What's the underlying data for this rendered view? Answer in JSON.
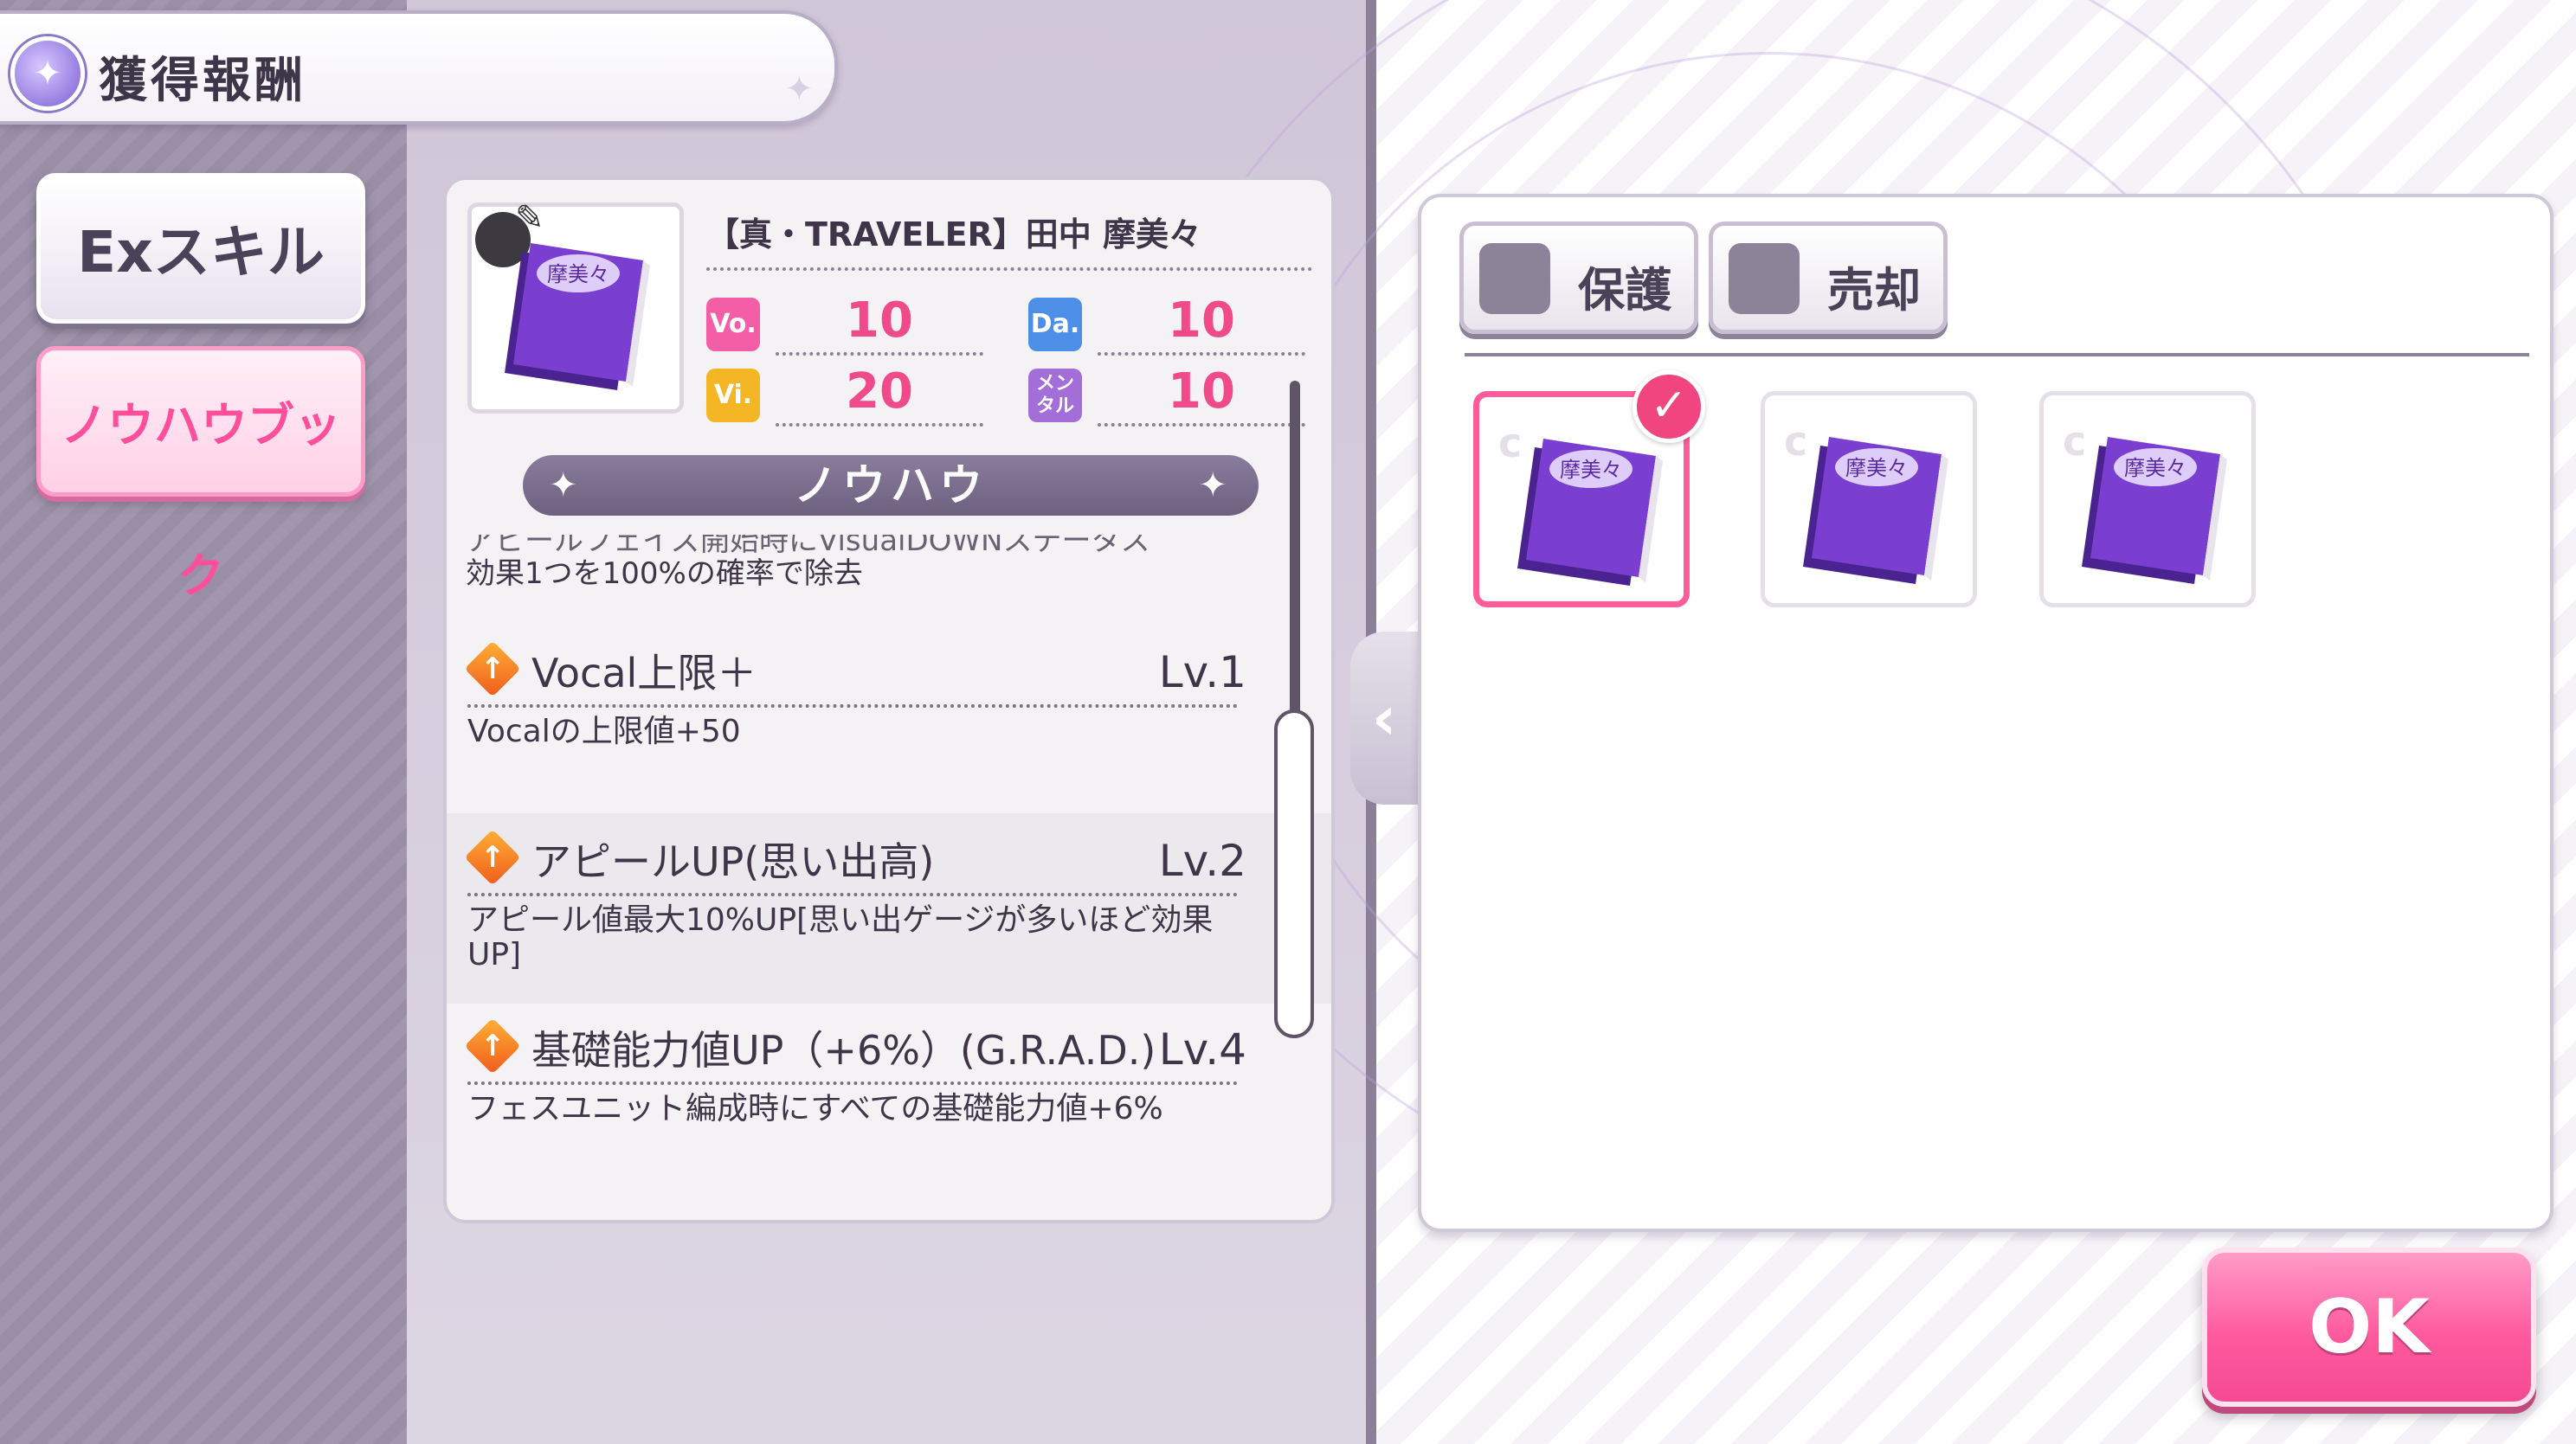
{
  "header": {
    "title": "獲得報酬"
  },
  "tabs": [
    {
      "label": "Exスキル",
      "active": false
    },
    {
      "label": "ノウハウブック",
      "active": true
    }
  ],
  "card": {
    "name": "【真・TRAVELER】田中 摩美々",
    "book_label": "摩美々",
    "stats": [
      {
        "badge": "Vo.",
        "value": "10",
        "color": "#f35ea6"
      },
      {
        "badge": "Da.",
        "value": "10",
        "color": "#4d8ee6"
      },
      {
        "badge": "Vi.",
        "value": "20",
        "color": "#f4b624"
      },
      {
        "badge": "メンタル",
        "value": "10",
        "color": "#a36ed8"
      }
    ]
  },
  "knowhow": {
    "title": "ノウハウ",
    "cut_text_line1": "アピールフェイズ開始時にVisualDOWNステータス",
    "cut_text_line2": "効果1つを100%の確率で除去",
    "items": [
      {
        "name": "Vocal上限＋",
        "level": "Lv.1",
        "desc": "Vocalの上限値+50"
      },
      {
        "name": "アピールUP(思い出高)",
        "level": "Lv.2",
        "desc": "アピール値最大10%UP[思い出ゲージが多いほど効果UP]"
      },
      {
        "name": "基礎能力値UP（+6%）(G.R.A.D.)",
        "level": "Lv.4",
        "desc": "フェスユニット編成時にすべての基礎能力値+6%"
      }
    ]
  },
  "filters": {
    "protect": "保護",
    "sell": "売却"
  },
  "inventory": [
    {
      "label": "摩美々",
      "selected": true
    },
    {
      "label": "摩美々",
      "selected": false
    },
    {
      "label": "摩美々",
      "selected": false
    }
  ],
  "ok_label": "OK",
  "colors": {
    "accent_pink": "#ff5a9e",
    "stat_value": "#f04a8a",
    "book_purple": "#6a2fb5"
  }
}
